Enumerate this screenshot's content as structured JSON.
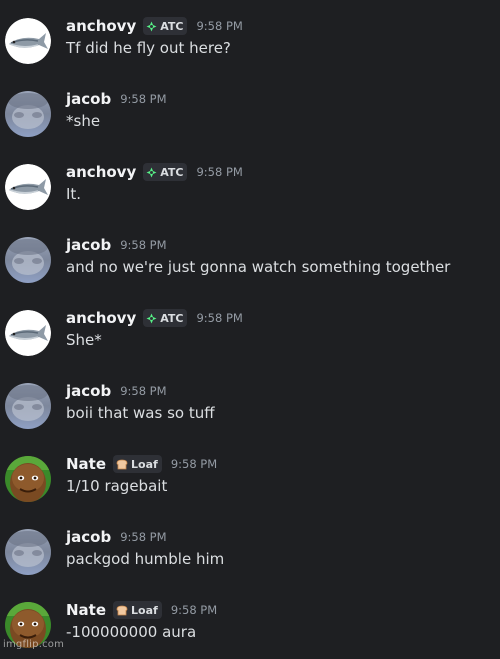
{
  "messages": [
    {
      "user": "anchovy",
      "avatar": "fish-avatar",
      "tag": "ATC",
      "tag_icon": "atc-icon",
      "time": "9:58 PM",
      "text": "Tf did he fly out here?"
    },
    {
      "user": "jacob",
      "avatar": "blurry-avatar",
      "time": "9:58 PM",
      "text": "*she"
    },
    {
      "user": "anchovy",
      "avatar": "fish-avatar",
      "tag": "ATC",
      "tag_icon": "atc-icon",
      "time": "9:58 PM",
      "text": "It."
    },
    {
      "user": "jacob",
      "avatar": "blurry-avatar",
      "time": "9:58 PM",
      "text": "and no we're just gonna watch something together"
    },
    {
      "user": "anchovy",
      "avatar": "fish-avatar",
      "tag": "ATC",
      "tag_icon": "atc-icon",
      "time": "9:58 PM",
      "text": "She*"
    },
    {
      "user": "jacob",
      "avatar": "blurry-avatar",
      "time": "9:58 PM",
      "text": "boii that was so tuff"
    },
    {
      "user": "Nate",
      "avatar": "face-avatar",
      "tag": "Loaf",
      "tag_icon": "bread-icon",
      "time": "9:58 PM",
      "text": "1/10 ragebait"
    },
    {
      "user": "jacob",
      "avatar": "blurry-avatar",
      "time": "9:58 PM",
      "text": "packgod humble him"
    },
    {
      "user": "Nate",
      "avatar": "face-avatar",
      "tag": "Loaf",
      "tag_icon": "bread-icon",
      "time": "9:58 PM",
      "text": "-100000000 aura"
    }
  ],
  "watermark": "imgflip.com",
  "colors": {
    "background": "#1e1f22",
    "username": "#f2f3f5",
    "timestamp": "#949ba4",
    "message_text": "#dbdee1",
    "tag_background": "#2e3036",
    "atc_icon": "#57f287",
    "loaf_icon": "#f0c8a0"
  }
}
